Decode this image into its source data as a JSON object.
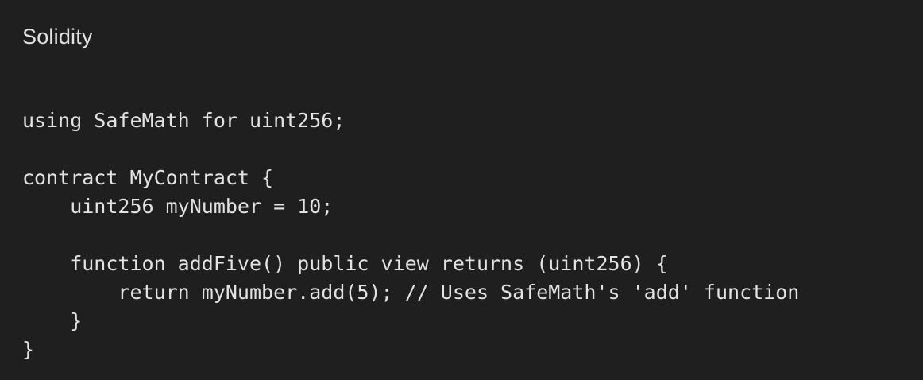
{
  "code_card": {
    "language": "Solidity",
    "lines": [
      "using SafeMath for uint256;",
      "",
      "contract MyContract {",
      "    uint256 myNumber = 10;",
      "",
      "    function addFive() public view returns (uint256) {",
      "        return myNumber.add(5); // Uses SafeMath's 'add' function",
      "    }",
      "}"
    ]
  }
}
